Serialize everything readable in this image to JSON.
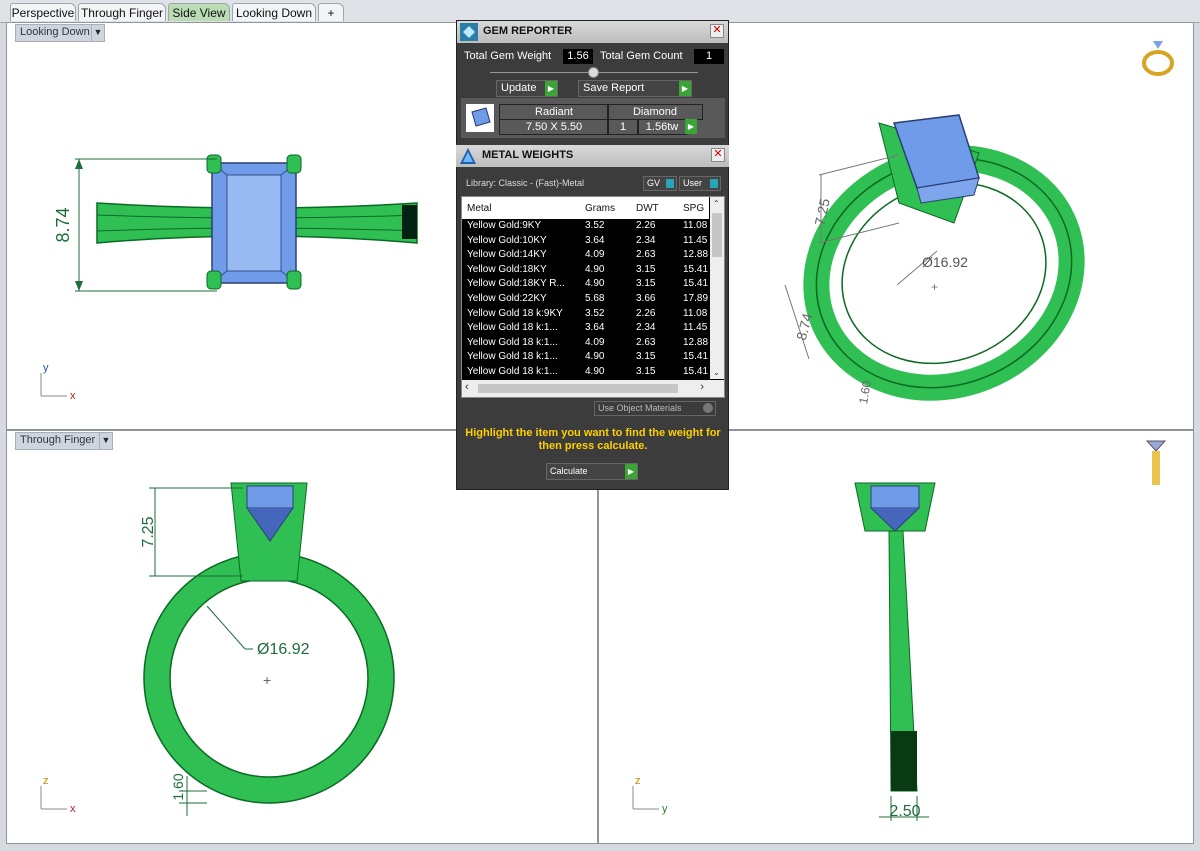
{
  "tabs": [
    "Perspective",
    "Through Finger",
    "Side View",
    "Looking Down",
    "+"
  ],
  "viewports": {
    "top_left": {
      "label": "Looking Down",
      "dim": "8.74",
      "axis_y": "y",
      "axis_x": "x"
    },
    "top_right": {
      "dia": "Ø16.92",
      "dim1": "7.25",
      "dim2": "8.74",
      "dim3": "1.60"
    },
    "bottom_left": {
      "label": "Through Finger",
      "dim1": "7.25",
      "dia": "Ø16.92",
      "dim2": "1.60",
      "axis_y": "z",
      "axis_x": "x"
    },
    "bottom_right": {
      "dim": "2.50",
      "axis_y": "z",
      "axis_x": "y"
    }
  },
  "gem_reporter": {
    "title": "GEM REPORTER",
    "total_weight_label": "Total Gem Weight",
    "total_weight": "1.56",
    "total_count_label": "Total Gem Count",
    "total_count": "1",
    "update_label": "Update",
    "save_label": "Save Report",
    "gem": {
      "shape": "Radiant",
      "type": "Diamond",
      "size": "7.50 X 5.50",
      "count": "1",
      "weight": "1.56tw"
    }
  },
  "metal_weights": {
    "title": "METAL WEIGHTS",
    "library": "Library: Classic - (Fast)-Metal",
    "gv_label": "GV",
    "user_label": "User",
    "columns": [
      "Metal",
      "Grams",
      "DWT",
      "SPG"
    ],
    "rows": [
      [
        "Yellow Gold:9KY",
        "3.52",
        "2.26",
        "11.08"
      ],
      [
        "Yellow Gold:10KY",
        "3.64",
        "2.34",
        "11.45"
      ],
      [
        "Yellow Gold:14KY",
        "4.09",
        "2.63",
        "12.88"
      ],
      [
        "Yellow Gold:18KY",
        "4.90",
        "3.15",
        "15.41"
      ],
      [
        "Yellow Gold:18KY R...",
        "4.90",
        "3.15",
        "15.41"
      ],
      [
        "Yellow Gold:22KY",
        "5.68",
        "3.66",
        "17.89"
      ],
      [
        "Yellow Gold 18 k:9KY",
        "3.52",
        "2.26",
        "11.08"
      ],
      [
        "Yellow Gold 18 k:1...",
        "3.64",
        "2.34",
        "11.45"
      ],
      [
        "Yellow Gold 18 k:1...",
        "4.09",
        "2.63",
        "12.88"
      ],
      [
        "Yellow Gold 18 k:1...",
        "4.90",
        "3.15",
        "15.41"
      ],
      [
        "Yellow Gold 18 k:1...",
        "4.90",
        "3.15",
        "15.41"
      ]
    ],
    "use_object_materials": "Use Object Materials",
    "hint": "Highlight the item you want to find the weight for then press calculate.",
    "calculate_label": "Calculate"
  }
}
